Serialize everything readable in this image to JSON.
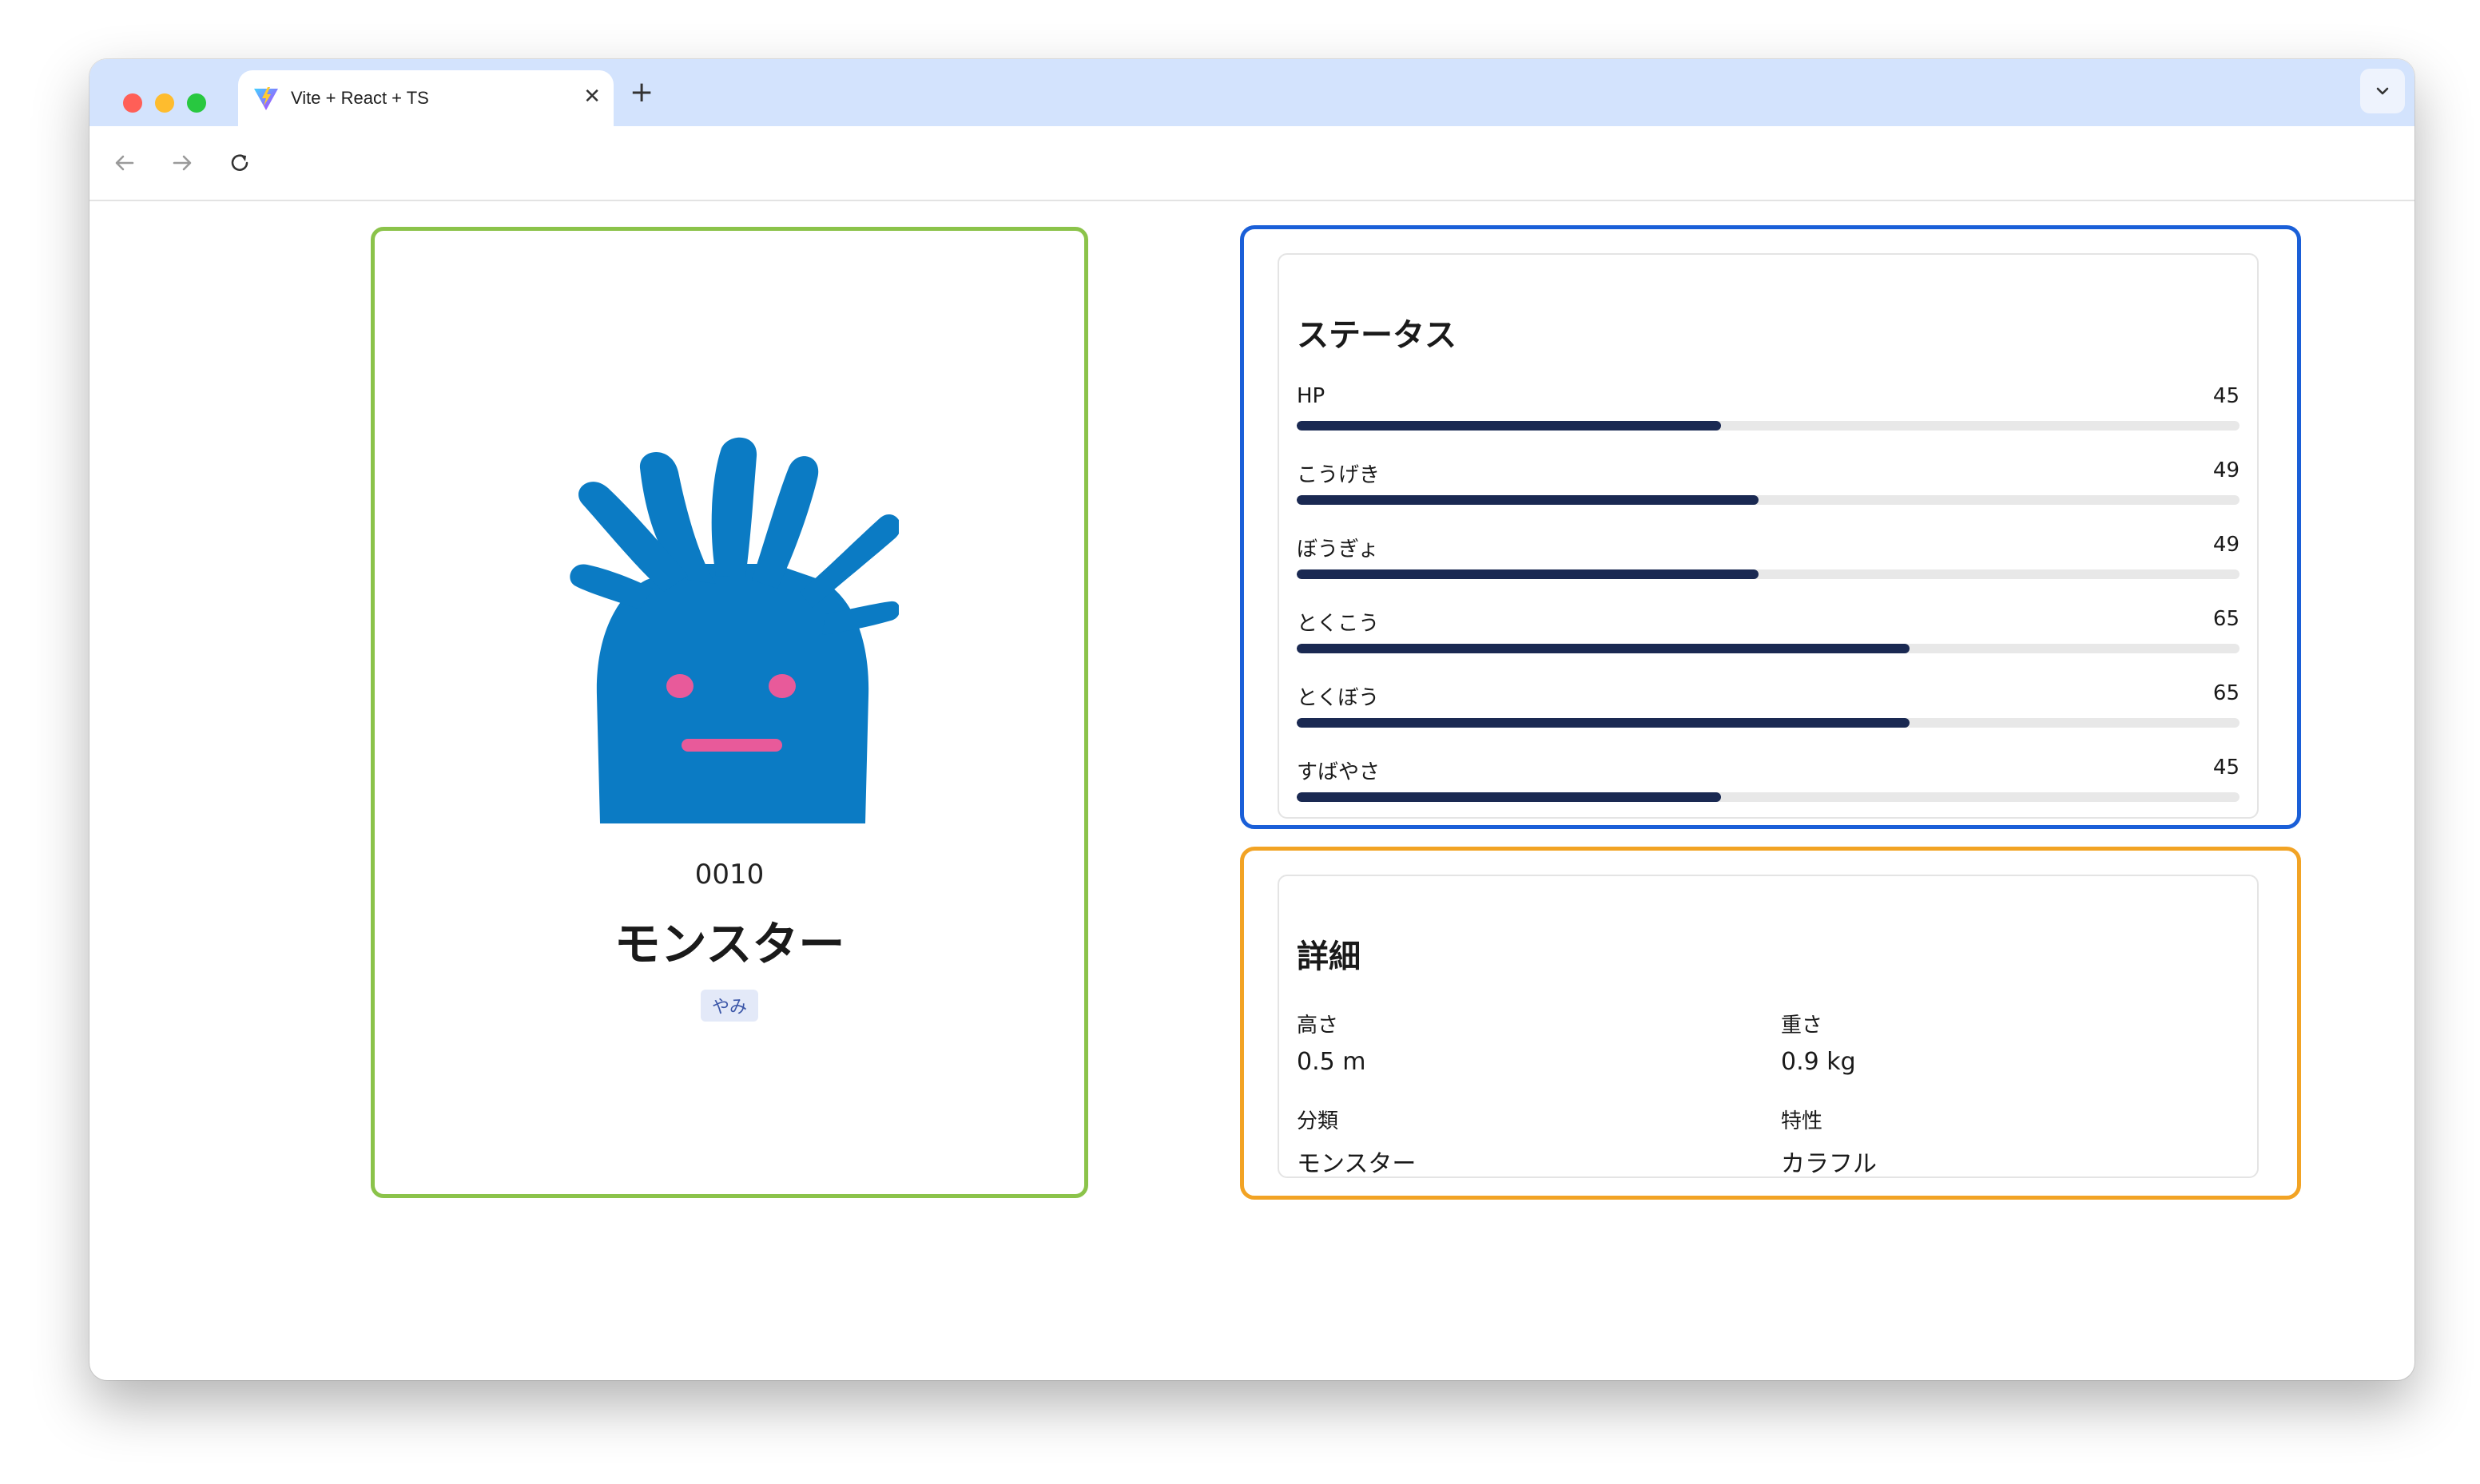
{
  "browser": {
    "tab_title": "Vite + React + TS",
    "close_glyph": "✕",
    "new_tab_glyph": "+"
  },
  "monster": {
    "id": "0010",
    "name": "モンスター",
    "type_badge": "やみ",
    "body_color": "#0b7bc4",
    "accent_color": "#e85a9a"
  },
  "status": {
    "title": "ステータス",
    "max_value": 100,
    "stats": [
      {
        "label": "HP",
        "value": 45
      },
      {
        "label": "こうげき",
        "value": 49
      },
      {
        "label": "ぼうぎょ",
        "value": 49
      },
      {
        "label": "とくこう",
        "value": 65
      },
      {
        "label": "とくぼう",
        "value": 65
      },
      {
        "label": "すばやさ",
        "value": 45
      }
    ]
  },
  "details": {
    "title": "詳細",
    "items": [
      {
        "label": "高さ",
        "value": "0.5 m"
      },
      {
        "label": "重さ",
        "value": "0.9 kg"
      },
      {
        "label": "分類",
        "value": "モンスター"
      },
      {
        "label": "特性",
        "value": "カラフル"
      }
    ]
  },
  "colors": {
    "card_green": "#8bc34a",
    "card_blue": "#1a5fd8",
    "card_orange": "#f2a324",
    "stat_fill": "#1a2952",
    "tabbar": "#d3e3fd"
  }
}
